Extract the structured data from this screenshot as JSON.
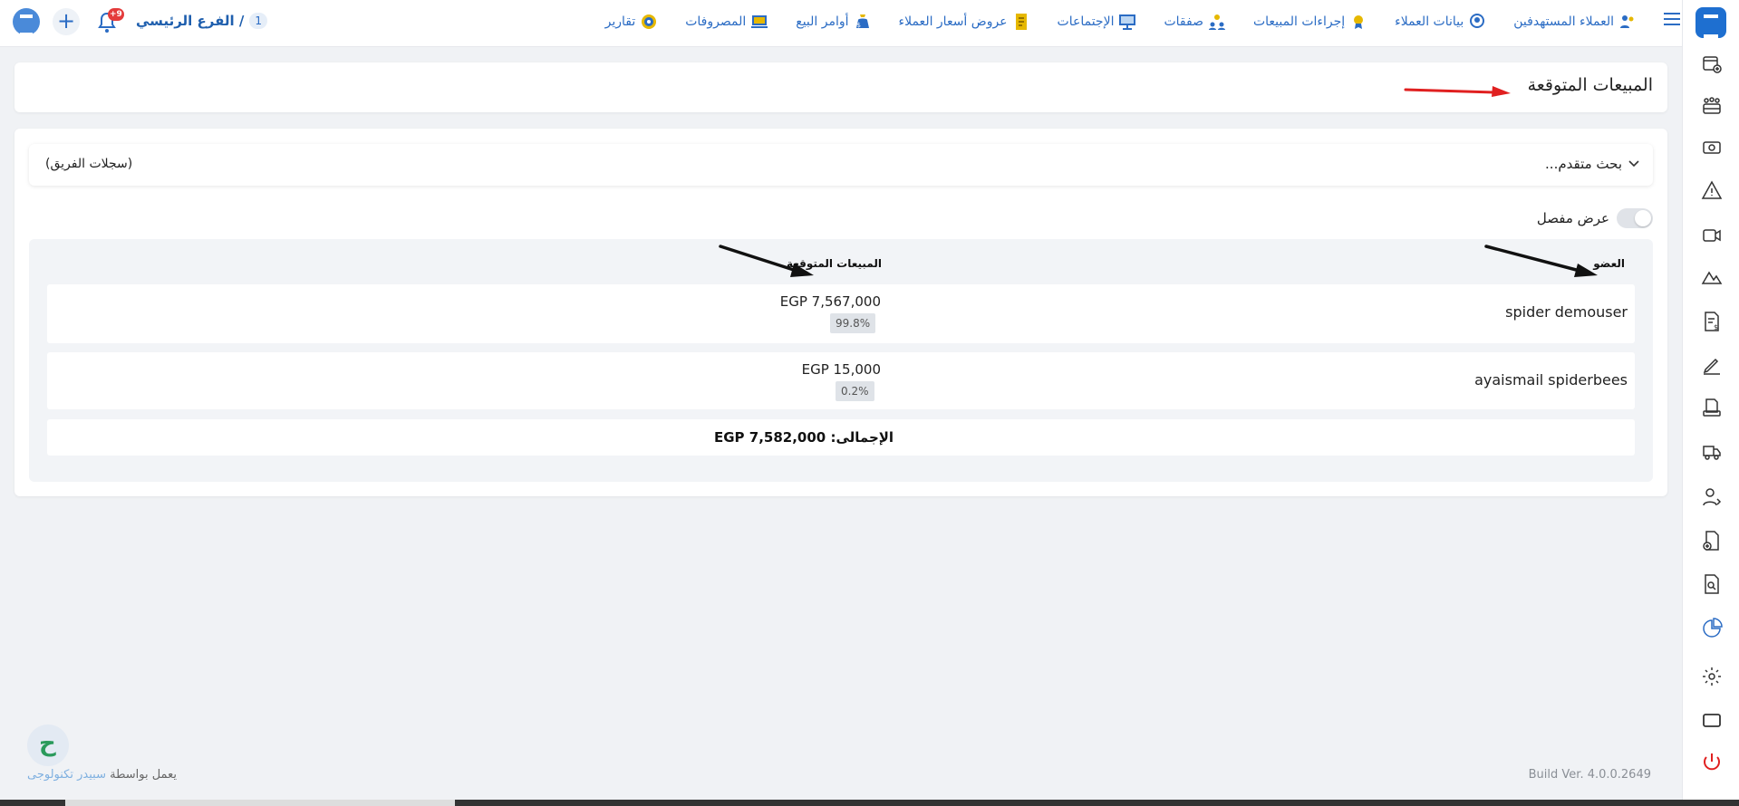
{
  "topbar": {
    "branch_number": "1",
    "branch_name": "الفرع الرئيسي /",
    "notification_count": "+9",
    "nav": [
      {
        "label": "العملاء المستهدفين",
        "icon": "target-customers-icon",
        "color": "#2b6cc4"
      },
      {
        "label": "بيانات العملاء",
        "icon": "customer-data-icon",
        "color": "#2b6cc4"
      },
      {
        "label": "إجراءات المبيعات",
        "icon": "sales-actions-icon",
        "color": "#e6b800"
      },
      {
        "label": "صفقات",
        "icon": "deals-icon",
        "color": "#2b6cc4"
      },
      {
        "label": "الإجتماعات",
        "icon": "meetings-icon",
        "color": "#2b6cc4"
      },
      {
        "label": "عروض أسعار العملاء",
        "icon": "quotations-icon",
        "color": "#e6b800"
      },
      {
        "label": "أوامر البيع",
        "icon": "sales-orders-icon",
        "color": "#2b6cc4"
      },
      {
        "label": "المصروفات",
        "icon": "expenses-icon",
        "color": "#2b6cc4"
      },
      {
        "label": "تقارير",
        "icon": "reports-icon",
        "color": "#e6b800"
      }
    ]
  },
  "page": {
    "title": "المبيعات المتوقعة"
  },
  "search": {
    "advanced_label": "بحث متقدم...",
    "team_records_label": "(سجلات الفريق)"
  },
  "toggle": {
    "label": "عرض مفصل"
  },
  "table": {
    "headers": {
      "member": "العضو",
      "expected_sales": "المبيعات المتوقعة"
    },
    "rows": [
      {
        "member": "spider demouser",
        "amount": "EGP 7,567,000",
        "percent": "99.8%"
      },
      {
        "member": "ayaismail spiderbees",
        "amount": "EGP 15,000",
        "percent": "0.2%"
      }
    ],
    "total": "الإجمالى: EGP 7,582,000"
  },
  "footer": {
    "powered_prefix": "يعمل بواسطة",
    "brand": "سبيدر تكنولوجى",
    "build": "Build Ver. 4.0.0.2649"
  },
  "colors": {
    "primary": "#2b6cc4",
    "brand": "#1e6fd0",
    "annotation_red": "#e02020",
    "annotation_black": "#111111"
  }
}
